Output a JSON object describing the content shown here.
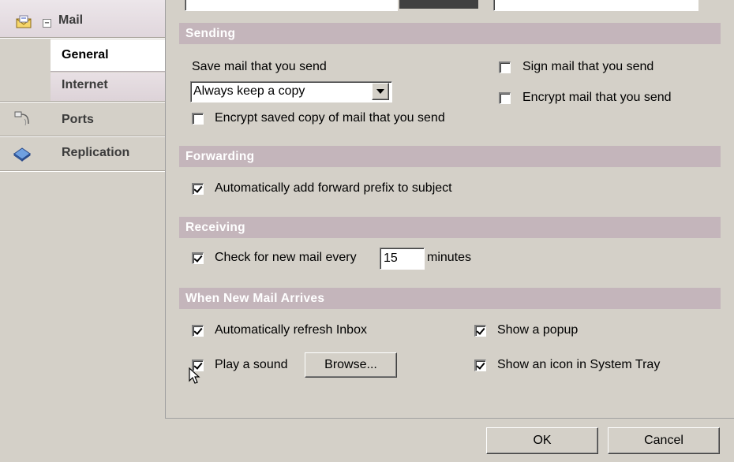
{
  "nav": {
    "mail_label": "Mail",
    "general_label": "General",
    "internet_label": "Internet",
    "ports_label": "Ports",
    "replication_label": "Replication"
  },
  "sending": {
    "header": "Sending",
    "save_mail_label": "Save mail that you send",
    "save_mail_value": "Always keep a copy",
    "encrypt_saved_label": "Encrypt saved copy of mail that you send",
    "encrypt_saved_checked": false,
    "sign_label": "Sign mail that you send",
    "sign_checked": false,
    "encrypt_mail_label": "Encrypt mail that you send",
    "encrypt_mail_checked": false
  },
  "forwarding": {
    "header": "Forwarding",
    "auto_prefix_label": "Automatically add forward prefix to subject",
    "auto_prefix_checked": true
  },
  "receiving": {
    "header": "Receiving",
    "check_label": "Check for new mail every",
    "check_checked": true,
    "interval_value": "15",
    "minutes_label": "minutes"
  },
  "new_mail": {
    "header": "When New Mail Arrives",
    "refresh_label": "Automatically refresh Inbox",
    "refresh_checked": true,
    "sound_label": "Play a sound",
    "sound_checked": true,
    "browse_label": "Browse...",
    "popup_label": "Show a popup",
    "popup_checked": true,
    "tray_label": "Show an icon in System Tray",
    "tray_checked": true
  },
  "footer": {
    "ok_label": "OK",
    "cancel_label": "Cancel"
  },
  "colors": {
    "section_header": "#c4b5bb",
    "nav_selected": "#ffffff",
    "window_bg": "#d4d0c8"
  }
}
